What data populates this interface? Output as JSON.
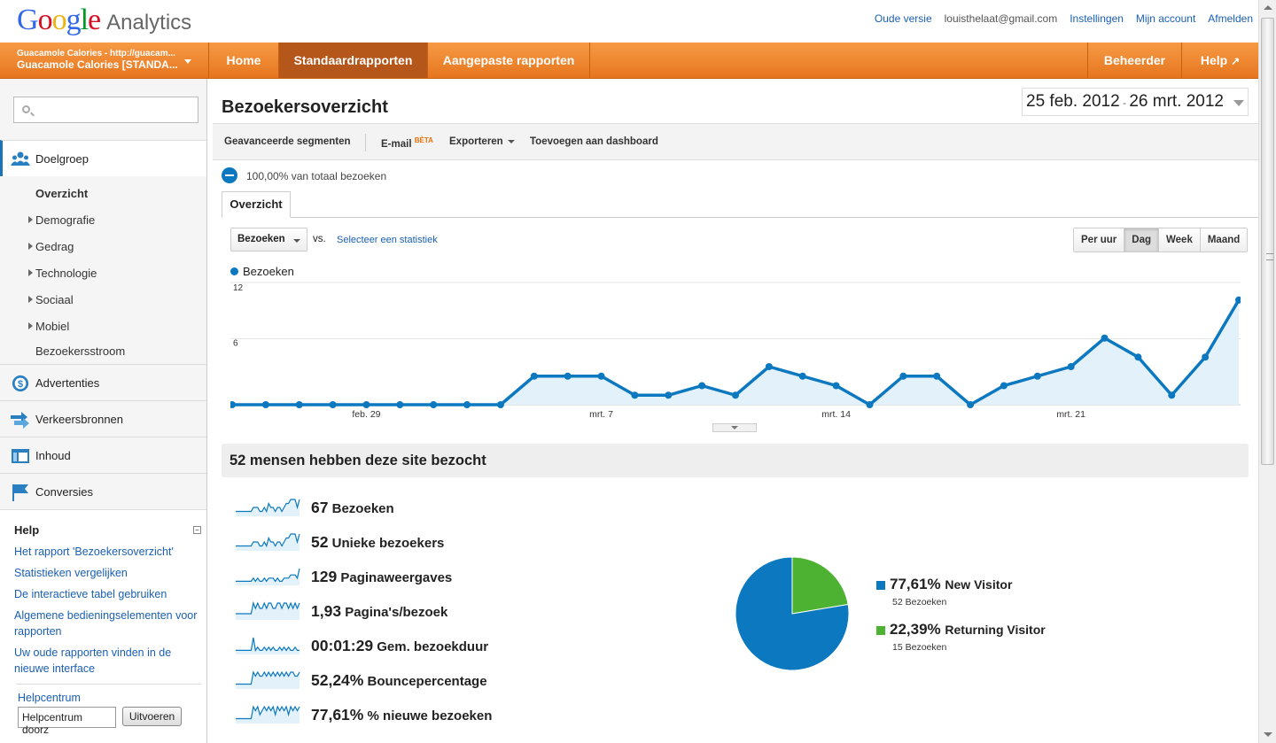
{
  "app": {
    "logo_google": "Google",
    "logo_product": "Analytics"
  },
  "toplinks": {
    "old_version": "Oude versie",
    "email": "louisthelaat@gmail.com",
    "settings": "Instellingen",
    "my_account": "Mijn account",
    "logout": "Afmelden"
  },
  "account": {
    "line1": "Guacamole Calories - http://guacam...",
    "line2": "Guacamole Calories [STANDA..."
  },
  "nav": {
    "home": "Home",
    "standard": "Standaardrapporten",
    "custom": "Aangepaste rapporten",
    "admin": "Beheerder",
    "help": "Help"
  },
  "sidebar": {
    "search_placeholder": "",
    "audience": "Doelgroep",
    "sub": [
      "Overzicht",
      "Demografie",
      "Gedrag",
      "Technologie",
      "Sociaal",
      "Mobiel",
      "Bezoekersstroom"
    ],
    "ads": "Advertenties",
    "traffic": "Verkeersbronnen",
    "content": "Inhoud",
    "conversions": "Conversies"
  },
  "help": {
    "title": "Help",
    "collapse": "−",
    "links": [
      "Het rapport 'Bezoekersoverzicht'",
      "Statistieken vergelijken",
      "De interactieve tabel gebruiken",
      "Algemene bedieningselementen voor rapporten",
      "Uw oude rapporten vinden in de nieuwe interface"
    ],
    "center": "Helpcentrum",
    "input_value": "Helpcentrum doorz",
    "go": "Uitvoeren"
  },
  "report": {
    "title": "Bezoekersoverzicht",
    "date_from": "25 feb. 2012",
    "date_sep": " - ",
    "date_to": "26 mrt. 2012",
    "toolbar": {
      "segments": "Geavanceerde segmenten",
      "email": "E-mail",
      "beta": "BÈTA",
      "export": "Exporteren",
      "dashboard": "Toevoegen aan dashboard"
    },
    "segment_text": "100,00% van totaal bezoeken",
    "tab": "Overzicht",
    "metric": "Bezoeken",
    "vs": "vs.",
    "select_stat": "Selecteer een statistiek",
    "granularity": [
      "Per uur",
      "Dag",
      "Week",
      "Maand"
    ],
    "granularity_selected": "Dag",
    "legend": "Bezoeken",
    "visitors_head": "52 mensen hebben deze site bezocht"
  },
  "stats": [
    {
      "value": "67",
      "label": "Bezoeken",
      "spark": [
        1,
        1,
        1,
        1,
        1,
        1,
        1,
        1,
        2,
        2,
        2,
        1,
        1,
        2,
        1,
        3,
        2,
        2,
        1,
        2,
        2,
        1,
        2,
        3,
        3,
        4,
        4,
        4,
        2,
        4
      ]
    },
    {
      "value": "52",
      "label": "Unieke bezoekers",
      "spark": [
        1,
        1,
        1,
        1,
        1,
        1,
        1,
        1,
        2,
        2,
        2,
        1,
        1,
        2,
        1,
        3,
        2,
        2,
        1,
        2,
        2,
        1,
        2,
        3,
        3,
        4,
        4,
        4,
        2,
        4
      ]
    },
    {
      "value": "129",
      "label": "Paginaweergaves",
      "spark": [
        1,
        1,
        1,
        1,
        1,
        1,
        1,
        1,
        2,
        1,
        2,
        1,
        1,
        2,
        1,
        2,
        2,
        2,
        1,
        2,
        1,
        1,
        2,
        2,
        2,
        3,
        3,
        3,
        2,
        5
      ]
    },
    {
      "value": "1,93",
      "label": "Pagina's/bezoek",
      "spark": [
        1,
        1,
        1,
        1,
        1,
        1,
        1,
        1,
        3,
        2,
        3,
        2,
        2,
        3,
        2,
        3,
        3,
        2,
        2,
        3,
        3,
        2,
        3,
        3,
        2,
        3,
        2,
        3,
        2,
        3
      ]
    },
    {
      "value": "00:01:29",
      "label": "Gem. bezoekduur",
      "spark": [
        1,
        1,
        1,
        1,
        1,
        1,
        1,
        1,
        5,
        1,
        2,
        1,
        1,
        2,
        1,
        2,
        1,
        2,
        1,
        1,
        2,
        1,
        2,
        1,
        2,
        1,
        1,
        2,
        1,
        1
      ]
    },
    {
      "value": "52,24%",
      "label": "Bouncepercentage",
      "spark": [
        1,
        1,
        1,
        1,
        1,
        1,
        1,
        1,
        4,
        3,
        4,
        3,
        3,
        4,
        3,
        4,
        3,
        4,
        3,
        4,
        3,
        4,
        3,
        4,
        3,
        4,
        4,
        3,
        3,
        4
      ]
    },
    {
      "value": "77,61%",
      "label": "% nieuwe bezoeken",
      "spark": [
        1,
        1,
        1,
        1,
        1,
        1,
        1,
        1,
        4,
        3,
        4,
        2,
        3,
        4,
        3,
        4,
        3,
        4,
        2,
        4,
        3,
        4,
        3,
        4,
        2,
        4,
        3,
        4,
        3,
        4
      ]
    }
  ],
  "pie": {
    "slices": [
      {
        "name": "New Visitor",
        "pct_label": "77,61%",
        "value": 77.61,
        "sub": "52 Bezoeken",
        "color": "#0b78c0"
      },
      {
        "name": "Returning Visitor",
        "pct_label": "22,39%",
        "value": 22.39,
        "sub": "15 Bezoeken",
        "color": "#4db231"
      }
    ]
  },
  "chart_data": {
    "type": "area",
    "title": "",
    "legend": [
      "Bezoeken"
    ],
    "x_tick_labels": [
      "feb. 29",
      "mrt. 7",
      "mrt. 14",
      "mrt. 21"
    ],
    "y_tick_labels": [
      "6",
      "12"
    ],
    "ylim": [
      0,
      12
    ],
    "x": [
      "25 feb.",
      "26 feb.",
      "27 feb.",
      "28 feb.",
      "29 feb.",
      "1 mrt.",
      "2 mrt.",
      "3 mrt.",
      "4 mrt.",
      "5 mrt.",
      "6 mrt.",
      "7 mrt.",
      "8 mrt.",
      "9 mrt.",
      "10 mrt.",
      "11 mrt.",
      "12 mrt.",
      "13 mrt.",
      "14 mrt.",
      "15 mrt.",
      "16 mrt.",
      "17 mrt.",
      "18 mrt.",
      "19 mrt.",
      "20 mrt.",
      "21 mrt.",
      "22 mrt.",
      "23 mrt.",
      "24 mrt.",
      "25 mrt.",
      "26 mrt."
    ],
    "series": [
      {
        "name": "Bezoeken",
        "values": [
          0,
          0,
          0,
          0,
          0,
          0,
          0,
          0,
          0,
          3,
          3,
          3,
          1,
          1,
          2,
          1,
          4,
          3,
          2,
          0,
          3,
          3,
          0,
          2,
          3,
          4,
          7,
          5,
          1,
          5,
          11
        ],
        "color": "#0b78c0"
      }
    ],
    "grid": true
  }
}
